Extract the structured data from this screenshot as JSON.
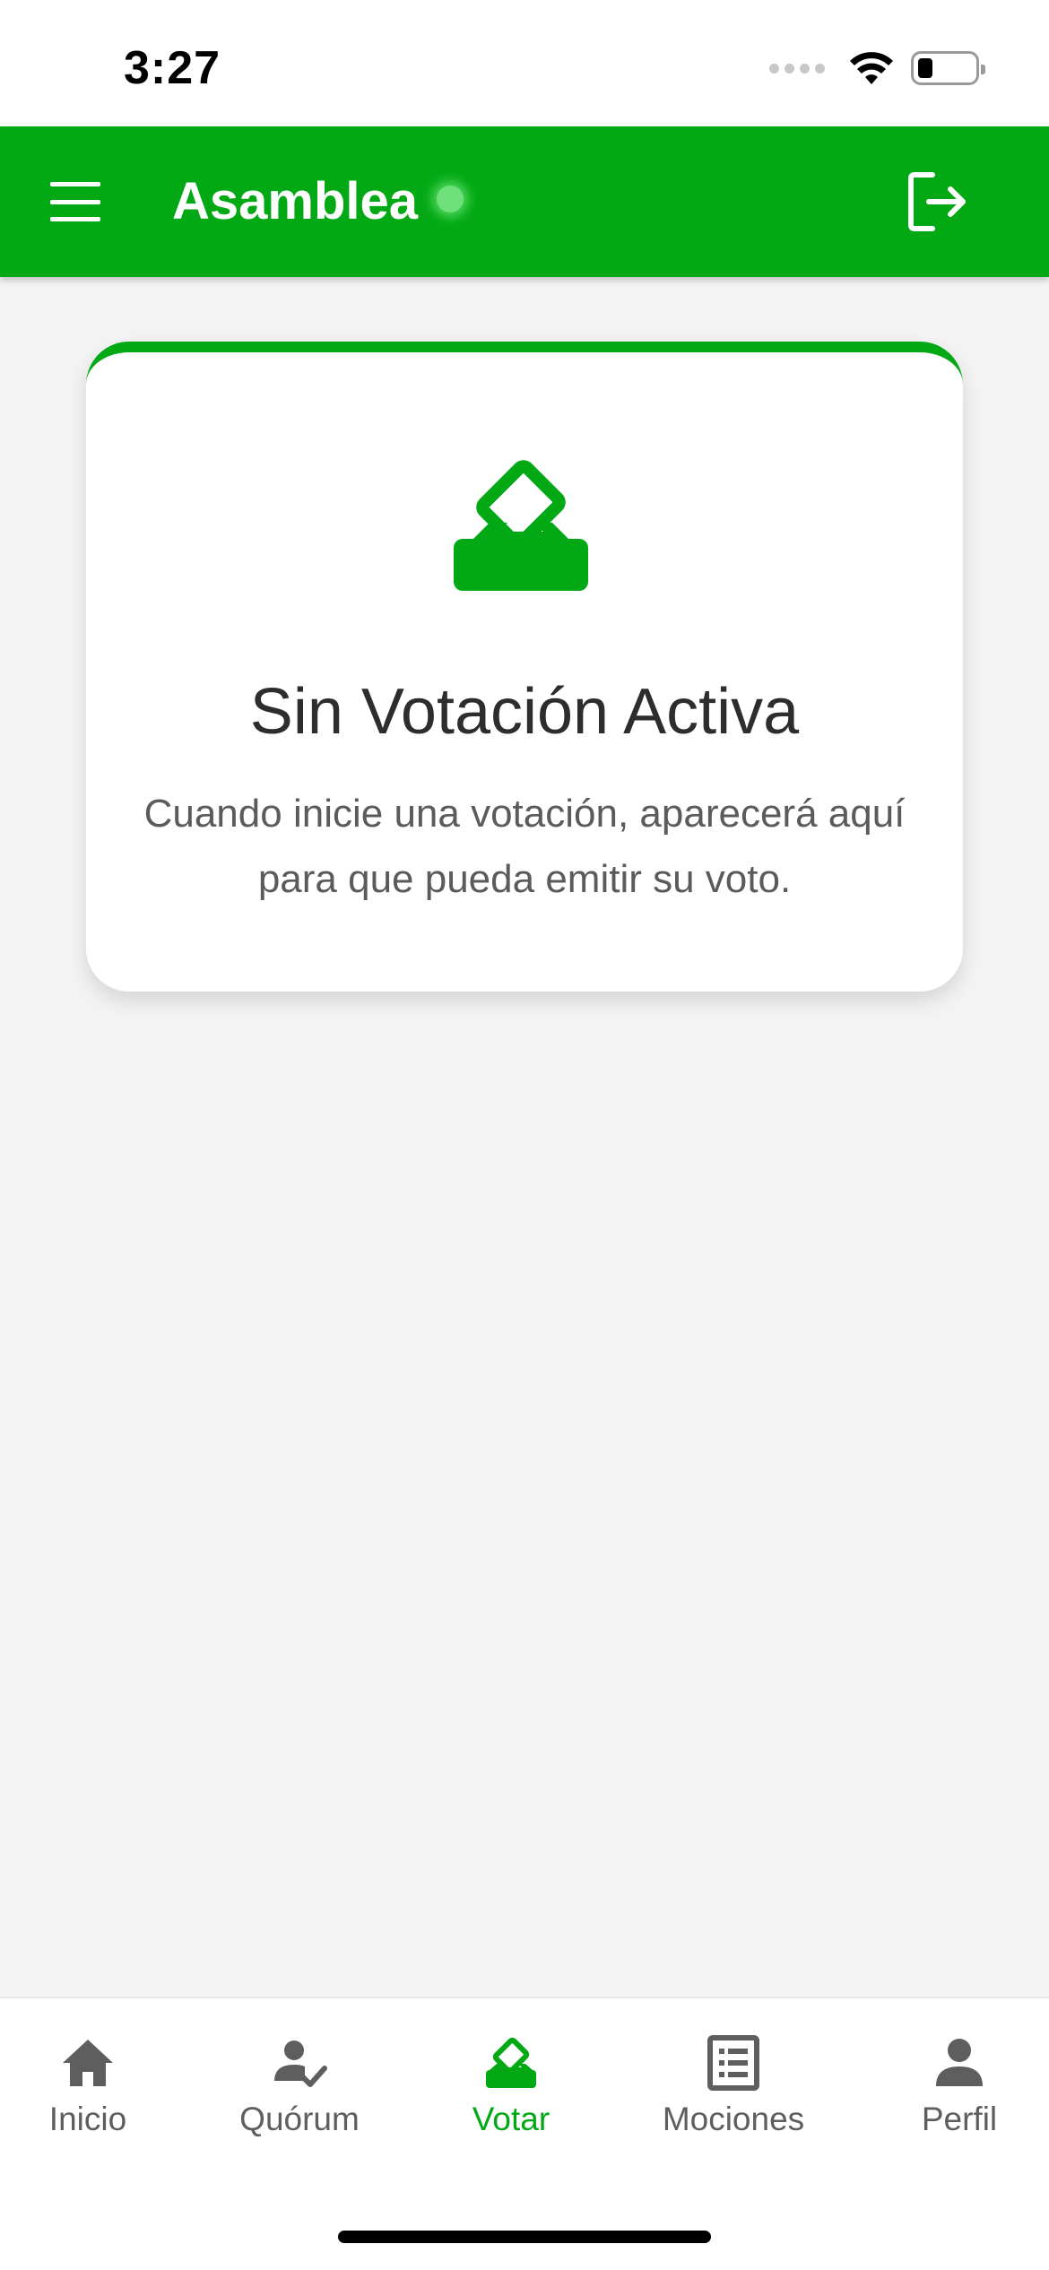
{
  "status_bar": {
    "time": "3:27"
  },
  "app_bar": {
    "title": "Asamblea",
    "color": "#03a914"
  },
  "card": {
    "title": "Sin Votación Activa",
    "description": "Cuando inicie una votación, aparecerá aquí para que pueda emitir su voto.",
    "icon": "ballot-box-icon"
  },
  "bottom_nav": {
    "items": [
      {
        "label": "Inicio",
        "icon": "home-icon",
        "active": false
      },
      {
        "label": "Quórum",
        "icon": "person-check-icon",
        "active": false
      },
      {
        "label": "Votar",
        "icon": "ballot-box-icon",
        "active": true
      },
      {
        "label": "Mociones",
        "icon": "document-list-icon",
        "active": false
      },
      {
        "label": "Perfil",
        "icon": "person-icon",
        "active": false
      }
    ]
  },
  "colors": {
    "accent": "#03a914",
    "inactive": "#5e5e5e",
    "background": "#f3f3f3"
  }
}
